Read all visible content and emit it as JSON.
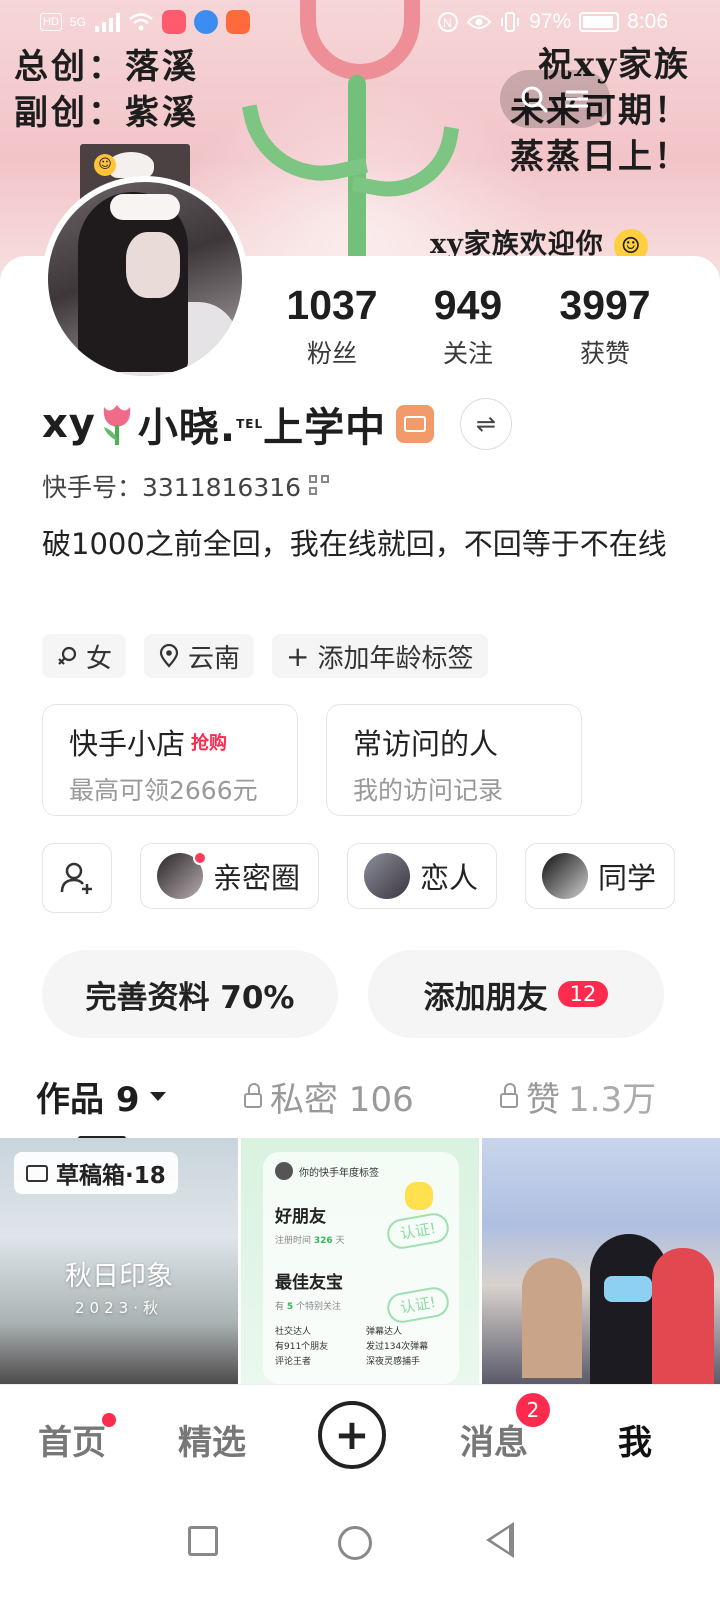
{
  "status_bar": {
    "network_chip": "HD",
    "signal": "5G",
    "battery": "97%",
    "time": "8:06"
  },
  "banner": {
    "left_text": "总创：落溪\n副创：紫溪",
    "right_text": "祝xy家族\n未来可期！\n蒸蒸日上！",
    "bottom_text": "xy家族欢迎你"
  },
  "profile": {
    "stats": [
      {
        "value": "1037",
        "label": "粉丝"
      },
      {
        "value": "949",
        "label": "关注"
      },
      {
        "value": "3997",
        "label": "获赞"
      }
    ],
    "name_prefix": "xy",
    "name_main": "小晓.",
    "name_sup": "TEL",
    "name_suffix": "上学中",
    "kuaishou_id": "快手号：3311816316",
    "bio": "破1000之前全回，我在线就回，不回等于不在线",
    "tags": [
      {
        "icon": "gender-female-icon",
        "label": "女"
      },
      {
        "icon": "location-pin-icon",
        "label": "云南"
      },
      {
        "icon": "plus-icon",
        "label": "添加年龄标签"
      }
    ]
  },
  "tiles": [
    {
      "title": "快手小店",
      "hot": "抢购",
      "subtitle": "最高可领2666元"
    },
    {
      "title": "常访问的人",
      "hot": "",
      "subtitle": "我的访问记录"
    }
  ],
  "relations": [
    "亲密圈",
    "恋人",
    "同学"
  ],
  "actions": {
    "complete_profile": "完善资料 70%",
    "add_friends": "添加朋友",
    "add_friends_count": "12"
  },
  "tabs": {
    "works": "作品 9",
    "private": "私密 106",
    "liked_label": "赞",
    "liked_count": "1.3万"
  },
  "grid": {
    "draft": "草稿箱·18",
    "autumn_title": "秋日印象",
    "autumn_sub": "2023·秋",
    "year_header": "你的快手年度标签",
    "good_friend": "好朋友",
    "good_friend_sub_pre": "注册时间",
    "good_friend_days": "326",
    "good_friend_sub_post": "天",
    "best_friend": "最佳友宝",
    "best_friend_sub_pre": "有",
    "best_friend_count": "5",
    "best_friend_sub_post": "个特别关注",
    "verify": "认证!",
    "mini": [
      "社交达人",
      "弹幕达人",
      "有911个朋友",
      "发过134次弹幕",
      "评论王者",
      "深夜灵感捕手"
    ]
  },
  "bottom_nav": {
    "home": "首页",
    "featured": "精选",
    "messages": "消息",
    "messages_badge": "2",
    "me": "我"
  },
  "colors": {
    "accent_red": "#ff2b4e",
    "banner_pink": "#f2c4c8",
    "tulip_green": "#73c07a"
  }
}
